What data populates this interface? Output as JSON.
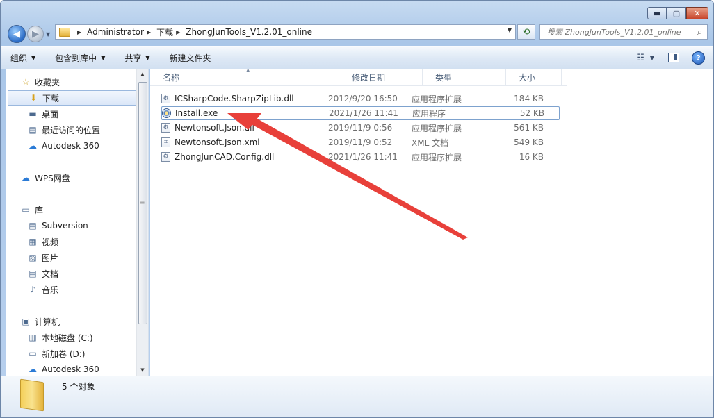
{
  "window": {
    "minimize": "▬",
    "maximize": "▢",
    "close": "✕"
  },
  "nav": {
    "back": "◀",
    "forward": "▶",
    "history": "▼"
  },
  "address": {
    "crumbs": [
      "Administrator",
      "下载",
      "ZhongJunTools_V1.2.01_online"
    ],
    "dropdown": "▼",
    "refresh": "⟲"
  },
  "search": {
    "placeholder": "搜索 ZhongJunTools_V1.2.01_online",
    "icon": "search-icon"
  },
  "toolbar": {
    "organize": "组织",
    "include_in_library": "包含到库中",
    "share": "共享",
    "new_folder": "新建文件夹",
    "view_icon": "☷",
    "help": "?"
  },
  "sidebar": {
    "items": [
      {
        "label": "收藏夹",
        "icon": "☆",
        "kind": "group"
      },
      {
        "label": "下载",
        "icon": "⬇",
        "kind": "item",
        "selected": true
      },
      {
        "label": "桌面",
        "icon": "▬",
        "kind": "item"
      },
      {
        "label": "最近访问的位置",
        "icon": "▤",
        "kind": "item"
      },
      {
        "label": "Autodesk 360",
        "icon": "☁",
        "kind": "item"
      },
      {
        "label": "WPS网盘",
        "icon": "☁",
        "kind": "group"
      },
      {
        "label": "库",
        "icon": "▭",
        "kind": "group"
      },
      {
        "label": "Subversion",
        "icon": "▤",
        "kind": "item"
      },
      {
        "label": "视频",
        "icon": "▦",
        "kind": "item"
      },
      {
        "label": "图片",
        "icon": "▨",
        "kind": "item"
      },
      {
        "label": "文档",
        "icon": "▤",
        "kind": "item"
      },
      {
        "label": "音乐",
        "icon": "♪",
        "kind": "item"
      },
      {
        "label": "计算机",
        "icon": "▣",
        "kind": "group"
      },
      {
        "label": "本地磁盘 (C:)",
        "icon": "▥",
        "kind": "item"
      },
      {
        "label": "新加卷 (D:)",
        "icon": "▭",
        "kind": "item"
      },
      {
        "label": "Autodesk 360",
        "icon": "☁",
        "kind": "item"
      }
    ]
  },
  "columns": [
    "名称",
    "修改日期",
    "类型",
    "大小"
  ],
  "files": [
    {
      "name": "ICSharpCode.SharpZipLib.dll",
      "date": "2012/9/20 16:50",
      "type": "应用程序扩展",
      "size": "184 KB",
      "icon": "dll"
    },
    {
      "name": "Install.exe",
      "date": "2021/1/26 11:41",
      "type": "应用程序",
      "size": "52 KB",
      "icon": "exe"
    },
    {
      "name": "Newtonsoft.Json.dll",
      "date": "2019/11/9 0:56",
      "type": "应用程序扩展",
      "size": "561 KB",
      "icon": "dll"
    },
    {
      "name": "Newtonsoft.Json.xml",
      "date": "2019/11/9 0:52",
      "type": "XML 文档",
      "size": "549 KB",
      "icon": "xml"
    },
    {
      "name": "ZhongJunCAD.Config.dll",
      "date": "2021/1/26 11:41",
      "type": "应用程序扩展",
      "size": "16 KB",
      "icon": "dll"
    }
  ],
  "status": {
    "count": "5 个对象"
  },
  "colors": {
    "annotation_arrow": "#e8403a",
    "selection_border": "#7da2ce"
  }
}
